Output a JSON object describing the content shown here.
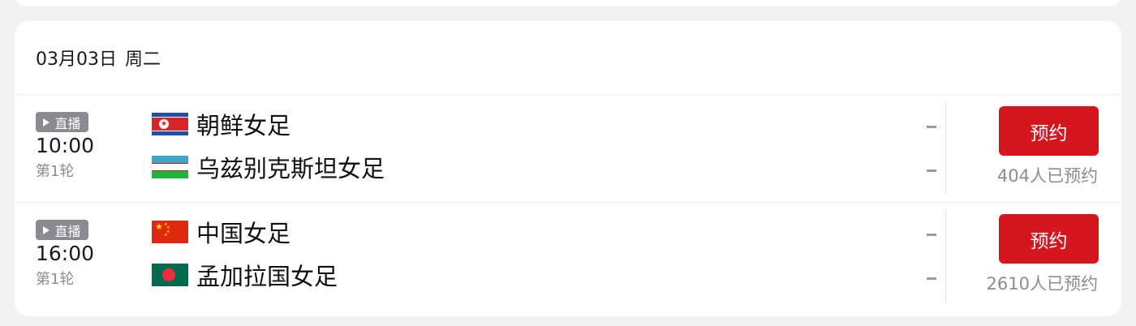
{
  "date_header": {
    "date": "03月03日",
    "weekday": "周二"
  },
  "matches": [
    {
      "badge": "直播",
      "time": "10:00",
      "round": "第1轮",
      "home": {
        "name": "朝鲜女足",
        "flag": "north-korea-flag-icon",
        "score": "-"
      },
      "away": {
        "name": "乌兹别克斯坦女足",
        "flag": "uzbekistan-flag-icon",
        "score": "-"
      },
      "reserve_label": "预约",
      "reserve_count": "404人已预约"
    },
    {
      "badge": "直播",
      "time": "16:00",
      "round": "第1轮",
      "home": {
        "name": "中国女足",
        "flag": "china-flag-icon",
        "score": "-"
      },
      "away": {
        "name": "孟加拉国女足",
        "flag": "bangladesh-flag-icon",
        "score": "-"
      },
      "reserve_label": "预约",
      "reserve_count": "2610人已预约"
    }
  ],
  "colors": {
    "accent": "#d5161f",
    "badge_bg": "#8a8a90",
    "muted_text": "#8c8c8c",
    "background": "#f2f2f2"
  }
}
